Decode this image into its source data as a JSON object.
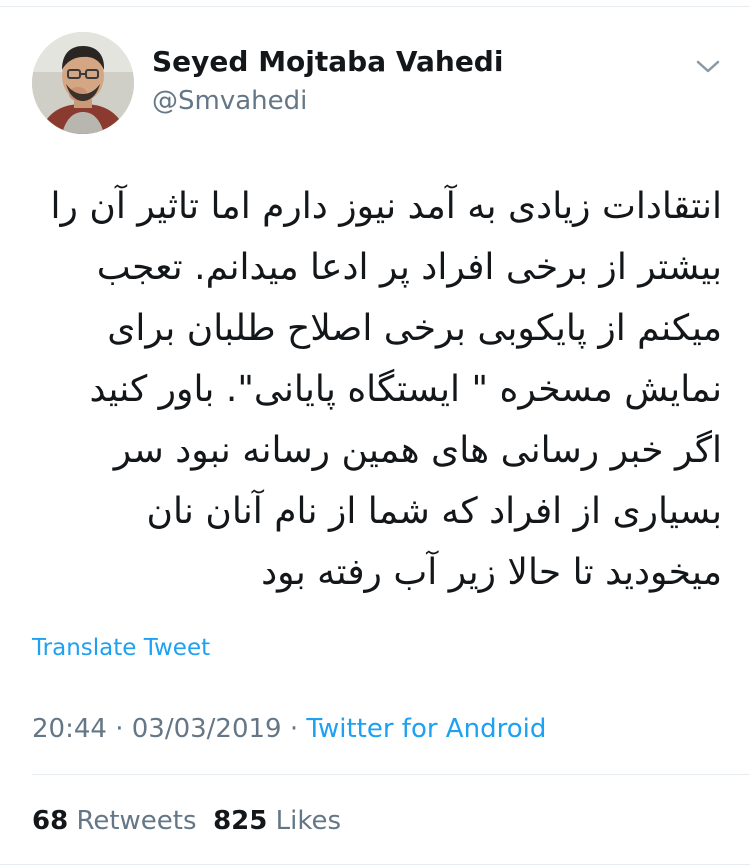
{
  "author": {
    "name": "Seyed Mojtaba Vahedi",
    "handle": "@Smvahedi"
  },
  "tweet": {
    "lines": [
      "انتقادات زیادی به آمد نیوز دارم اما تاثیر آن را",
      "بیشتر از برخی افراد پر ادعا میدانم. تعجب",
      "میکنم از پایکوبی برخی اصلاح طلبان برای",
      "نمایش مسخره \" ایستگاه پایانی\". باور کنید",
      "اگر خبر رسانی های همین رسانه نبود سر",
      "بسیاری از افراد که شما از نام آنان نان",
      "میخودید  تا حالا زیر آب رفته بود"
    ],
    "translate_label": "Translate Tweet"
  },
  "meta": {
    "time": "20:44",
    "separator": " · ",
    "date": "03/03/2019",
    "separator2": " · ",
    "source": "Twitter for Android"
  },
  "stats": {
    "retweets_count": "68",
    "retweets_label": "Retweets",
    "likes_count": "825",
    "likes_label": "Likes"
  },
  "icons": {
    "menu": "chevron-down-icon"
  },
  "colors": {
    "accent": "#1da1f2",
    "secondary_text": "#657786",
    "primary_text": "#14171a",
    "divider": "#e6ecf0"
  }
}
